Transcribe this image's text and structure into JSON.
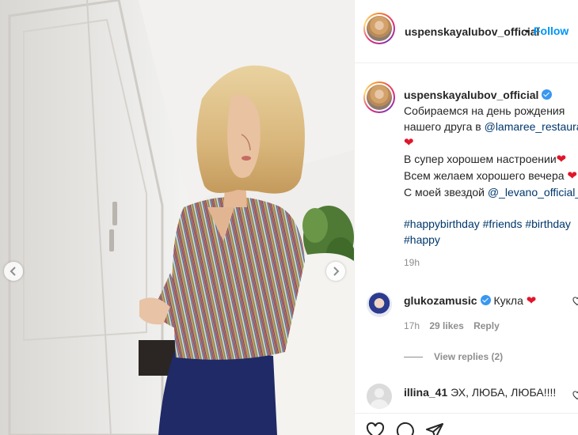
{
  "post": {
    "username": "uspenskayalubov_official",
    "follow_label": "Follow",
    "separator": "•",
    "caption": {
      "username": "uspenskayalubov_official",
      "line1": "Собираемся на день рождения",
      "line2_prefix": "нашего друга в ",
      "line2_mention": "@lamaree_restaurants",
      "line4": "В супер хорошем настроении",
      "line5": "Всем желаем хорошего вечера",
      "line6_prefix": "С моей звездой ",
      "line6_mention": "@_levano_official_",
      "hashtags_line1": [
        "#happybirthday",
        "#friends",
        "#birthday"
      ],
      "hashtags_line2": [
        "#happy"
      ],
      "time": "19h"
    }
  },
  "comments": [
    {
      "username": "glukozamusic",
      "text": "Кукла",
      "time": "17h",
      "likes": "29 likes",
      "reply_label": "Reply",
      "view_replies": "View replies (2)"
    },
    {
      "username": "illina_41",
      "text": "ЭХ, ЛЮБА, ЛЮБА!!!!"
    }
  ],
  "icons": {
    "heart": "heart-emoji",
    "verified": "verified-badge-icon",
    "prev": "chevron-left-icon",
    "next": "chevron-right-icon",
    "like": "heart-outline-icon",
    "comment": "comment-bubble-icon",
    "share": "paper-plane-icon"
  },
  "colors": {
    "accent": "#0095f6",
    "link": "#00376b",
    "heart": "#e0162b",
    "muted": "#8e8e8e"
  }
}
